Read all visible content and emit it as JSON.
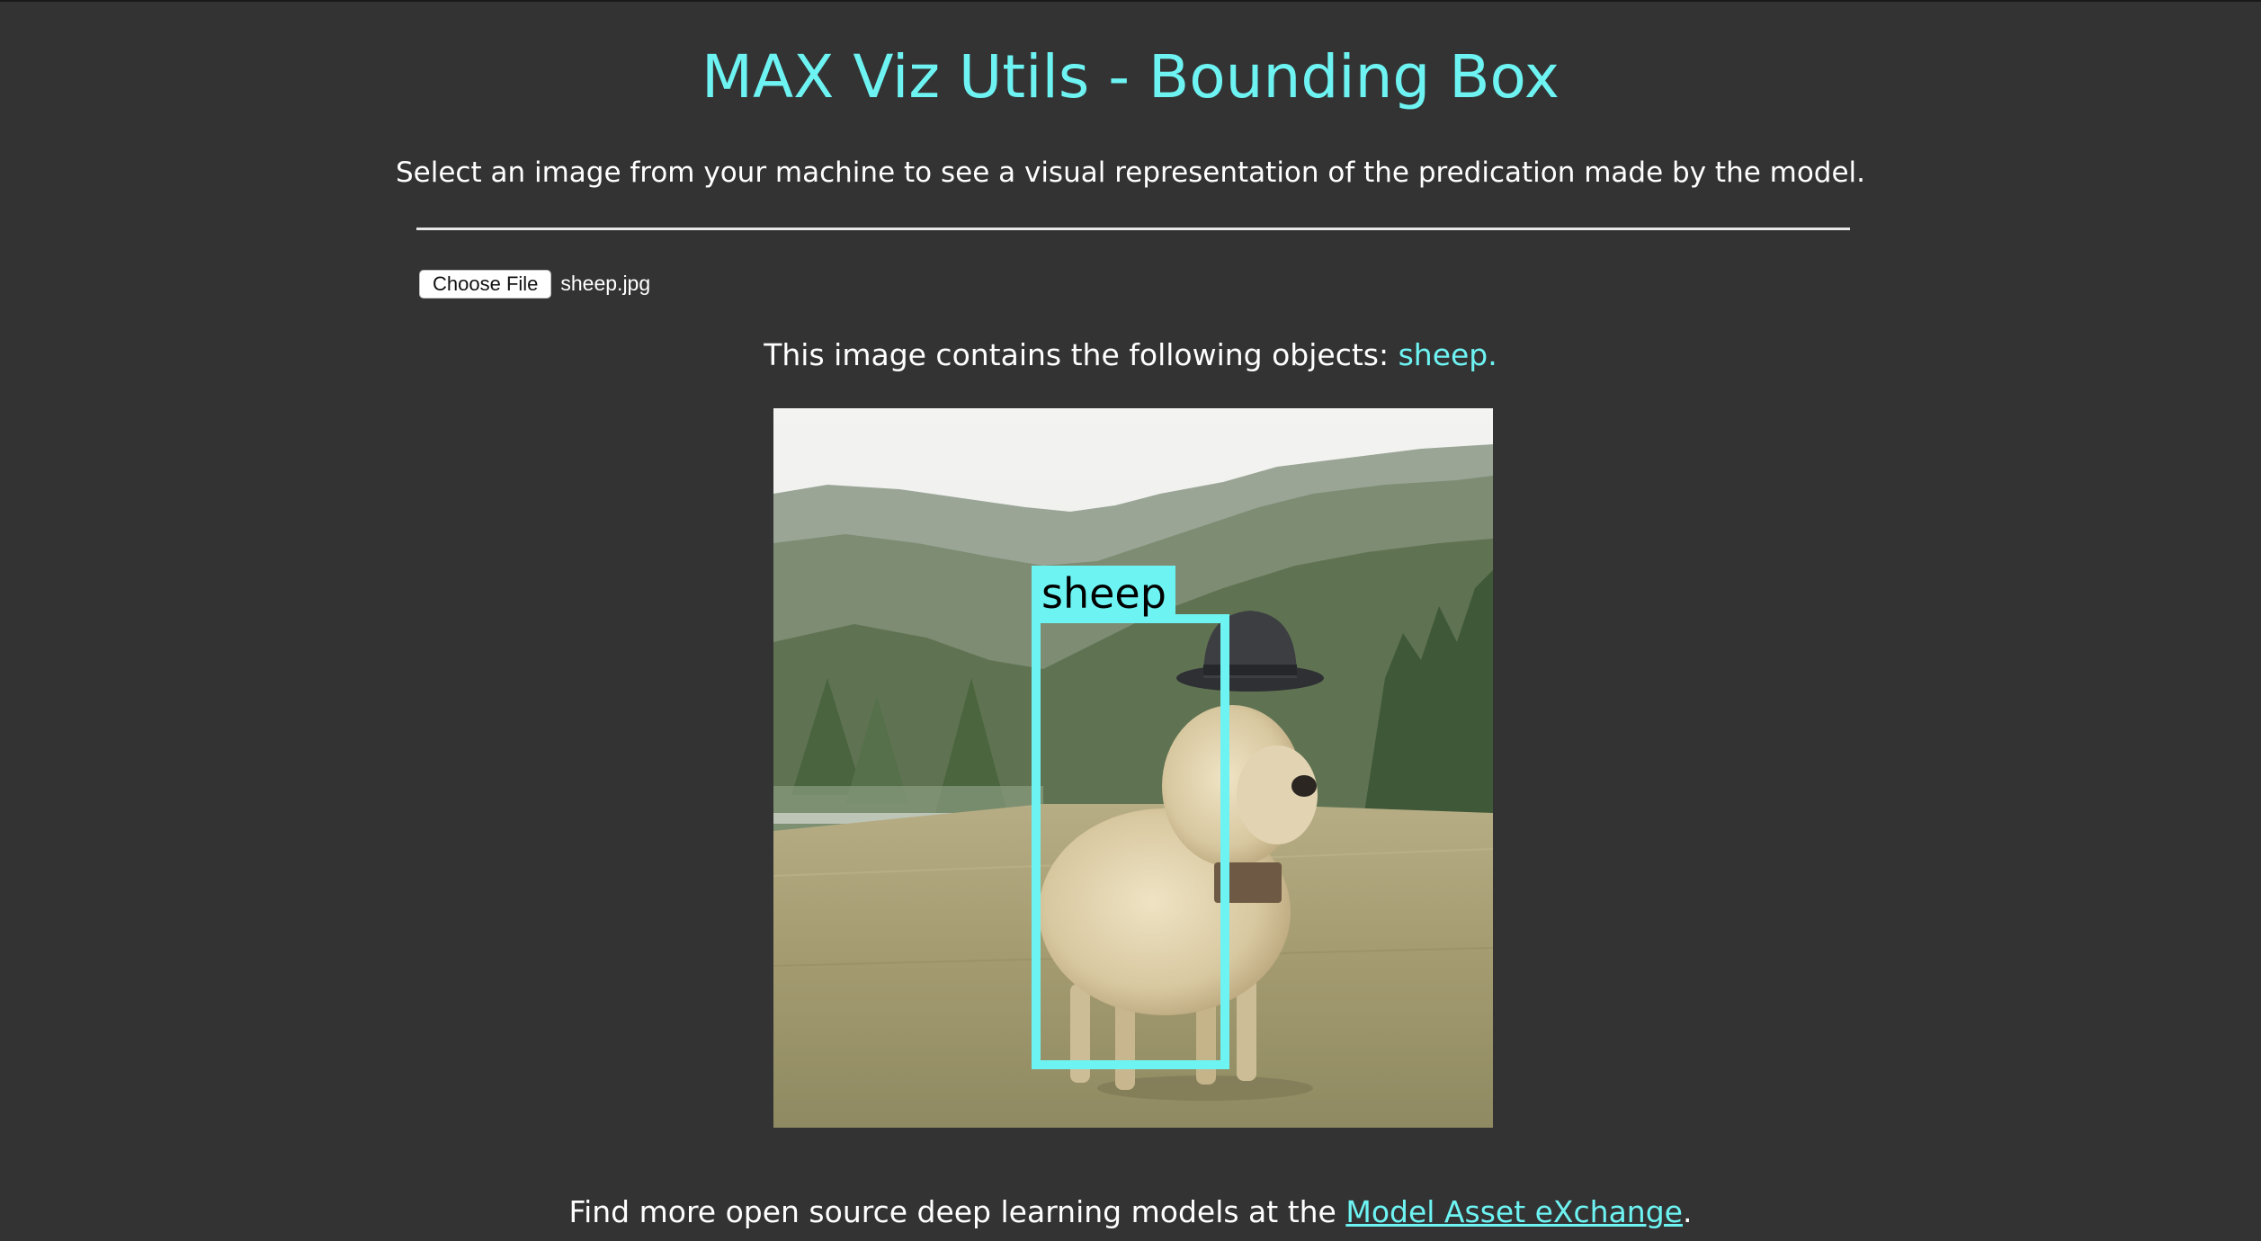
{
  "header": {
    "title": "MAX Viz Utils - Bounding Box",
    "subtitle": "Select an image from your machine to see a visual representation of the predication made by the model."
  },
  "file_input": {
    "button_label": "Choose File",
    "file_name": "sheep.jpg"
  },
  "result": {
    "prefix": "This image contains the following objects: ",
    "objects": "sheep."
  },
  "detection": {
    "label": "sheep",
    "box_color": "#6ef3f3"
  },
  "footer": {
    "prefix": "Find more open source deep learning models at the ",
    "link_text": "Model Asset eXchange",
    "suffix": "."
  },
  "colors": {
    "background": "#333333",
    "accent": "#6ef3f3",
    "text": "#ffffff"
  }
}
